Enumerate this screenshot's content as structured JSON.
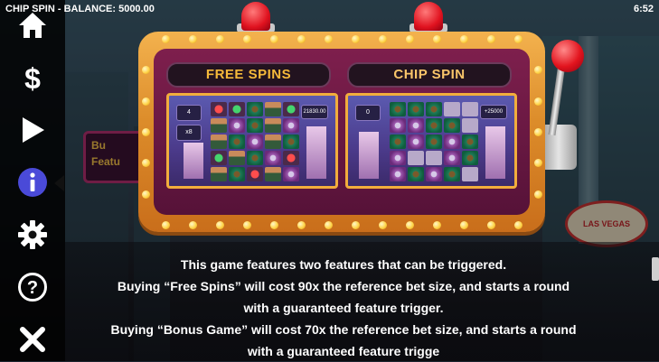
{
  "header": {
    "title": "CHIP SPIN - BALANCE: 5000.00",
    "clock": "6:52"
  },
  "sidebar": {
    "items": [
      {
        "name": "home",
        "icon": "home-icon"
      },
      {
        "name": "paytable",
        "icon": "dollar-icon"
      },
      {
        "name": "autoplay",
        "icon": "play-icon"
      },
      {
        "name": "info",
        "icon": "info-icon",
        "active": true
      },
      {
        "name": "settings",
        "icon": "gear-icon"
      },
      {
        "name": "help",
        "icon": "question-icon"
      },
      {
        "name": "close",
        "icon": "close-icon"
      }
    ],
    "active_color": "#4a4ad8"
  },
  "machine": {
    "panels": [
      {
        "title": "FREE SPINS",
        "left_badge_top": "4",
        "left_badge_bottom": "x8",
        "right_badge": "21830.00"
      },
      {
        "title": "CHIP SPIN",
        "left_badge_top": "0",
        "right_badge": "+25000"
      }
    ]
  },
  "background": {
    "sign_left": "Bu\nFeatu",
    "sign_right": "LAS VEGAS"
  },
  "info": {
    "lines": [
      "This game features two features that can be triggered.",
      "Buying “Free Spins” will cost 90x the reference bet size, and starts a round",
      "with a guaranteed feature trigger.",
      "Buying “Bonus Game” will cost 70x the reference bet size, and starts a round",
      "with a guaranteed feature trigge"
    ]
  }
}
